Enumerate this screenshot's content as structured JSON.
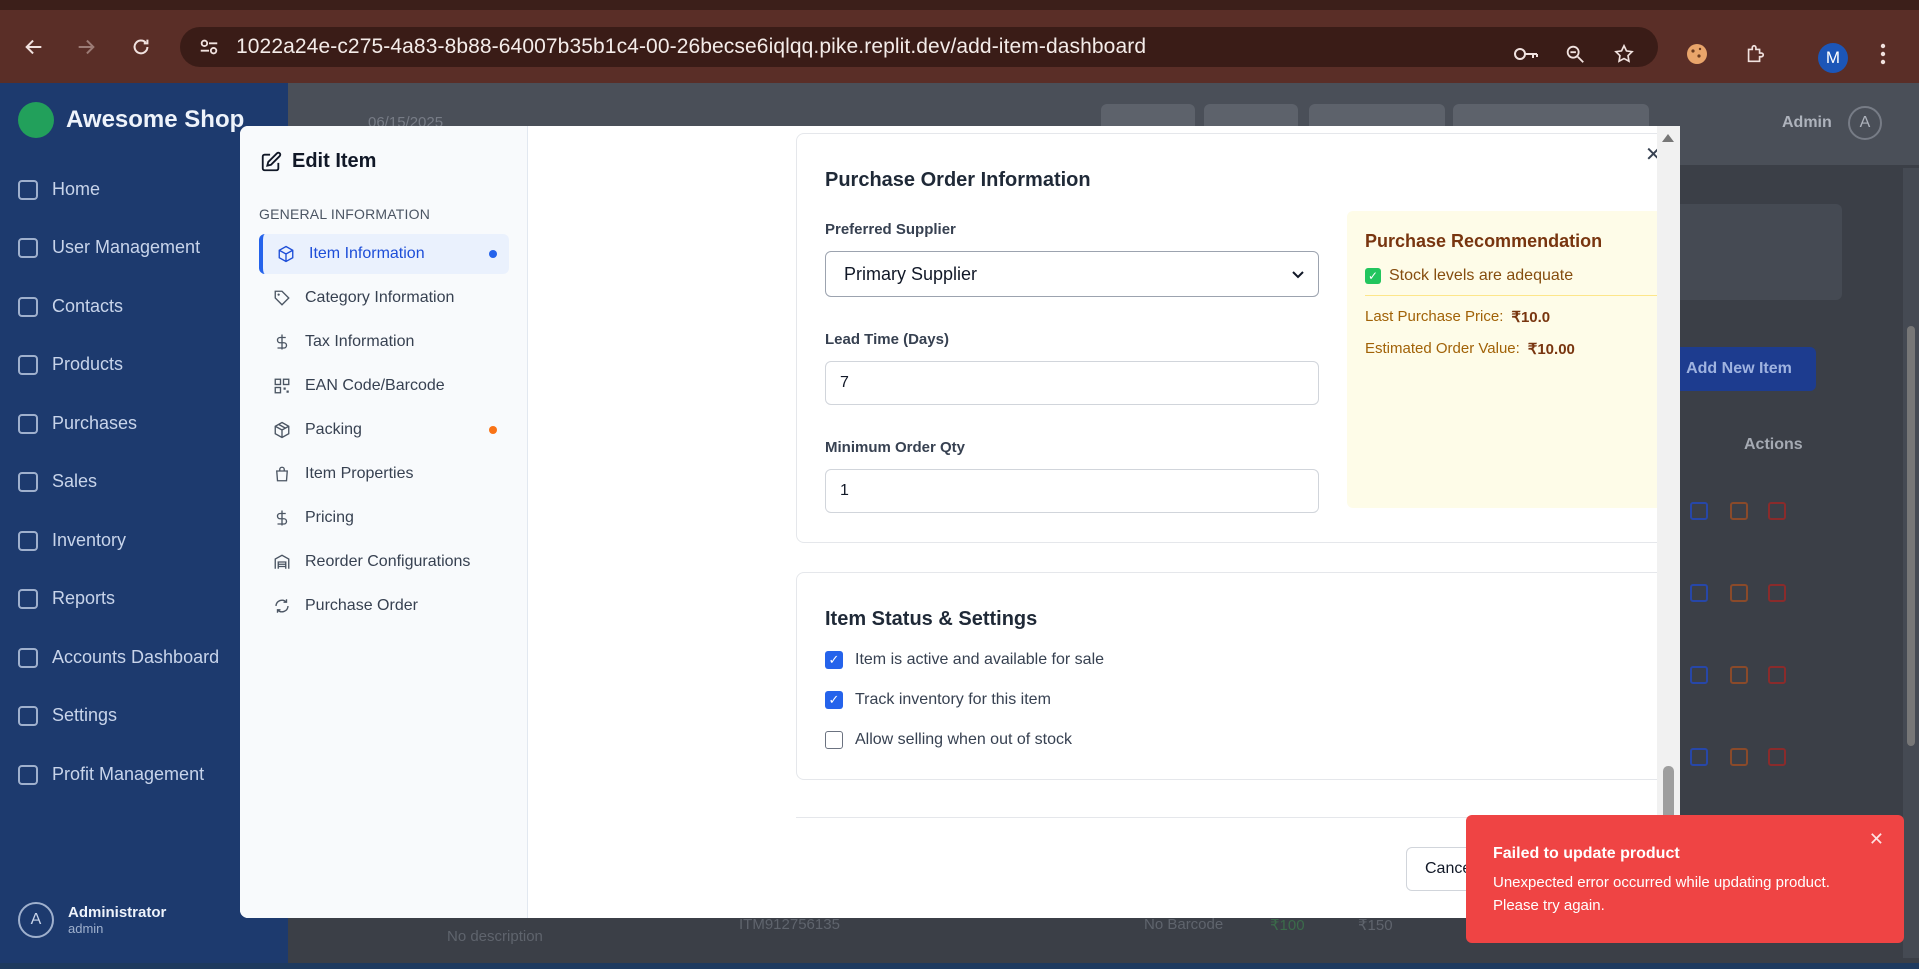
{
  "browser": {
    "url": "1022a24e-c275-4a83-8b88-64007b35b1c4-00-26becse6iqlqq.pike.replit.dev/add-item-dashboard",
    "profile_initial": "M"
  },
  "app": {
    "brand": "Awesome Shop",
    "header_date": "06/15/2025",
    "admin_label": "Admin",
    "admin_initial": "A",
    "sidebar": [
      {
        "label": "Home",
        "icon": "home-icon"
      },
      {
        "label": "User Management",
        "icon": "user-icon"
      },
      {
        "label": "Contacts",
        "icon": "contacts-icon"
      },
      {
        "label": "Products",
        "icon": "box-icon"
      },
      {
        "label": "Purchases",
        "icon": "download-icon"
      },
      {
        "label": "Sales",
        "icon": "bag-icon"
      },
      {
        "label": "Inventory",
        "icon": "package-icon"
      },
      {
        "label": "Reports",
        "icon": "chart-icon"
      },
      {
        "label": "Accounts Dashboard",
        "icon": "ledger-icon"
      },
      {
        "label": "Settings",
        "icon": "gear-icon"
      },
      {
        "label": "Profit Management",
        "icon": "rupee-icon"
      }
    ],
    "user": {
      "name": "Administrator",
      "role": "admin",
      "initial": "A"
    },
    "add_new_item": "Add New Item",
    "actions_header": "Actions",
    "bottom_row": {
      "description": "No description",
      "code": "ITM912756135",
      "barcode": "No Barcode",
      "price1": "₹100",
      "price2": "₹150"
    }
  },
  "modal": {
    "title": "Edit Item",
    "section": "GENERAL INFORMATION",
    "nav": [
      {
        "label": "Item Information",
        "icon": "cube-icon",
        "active": true,
        "dot": "#2563eb"
      },
      {
        "label": "Category Information",
        "icon": "tag-icon"
      },
      {
        "label": "Tax Information",
        "icon": "dollar-icon"
      },
      {
        "label": "EAN Code/Barcode",
        "icon": "qr-code-icon"
      },
      {
        "label": "Packing",
        "icon": "package-icon",
        "dot": "#f97316"
      },
      {
        "label": "Item Properties",
        "icon": "bag-icon"
      },
      {
        "label": "Pricing",
        "icon": "dollar-icon"
      },
      {
        "label": "Reorder Configurations",
        "icon": "warehouse-icon"
      },
      {
        "label": "Purchase Order",
        "icon": "refresh-icon"
      }
    ],
    "purchase": {
      "title": "Purchase Order Information",
      "supplier_label": "Preferred Supplier",
      "supplier_value": "Primary Supplier",
      "lead_label": "Lead Time (Days)",
      "lead_value": "7",
      "moq_label": "Minimum Order Qty",
      "moq_value": "1",
      "reco_title": "Purchase Recommendation",
      "reco_status": "Stock levels are adequate",
      "last_price_label": "Last Purchase Price:",
      "last_price_value": "₹10.0",
      "est_label": "Estimated Order Value:",
      "est_value": "₹10.00"
    },
    "status": {
      "title": "Item Status & Settings",
      "options": [
        {
          "label": "Item is active and available for sale",
          "checked": true
        },
        {
          "label": "Track inventory for this item",
          "checked": true
        },
        {
          "label": "Allow selling when out of stock",
          "checked": false
        }
      ]
    },
    "cancel": "Cancel"
  },
  "toast": {
    "title": "Failed to update product",
    "message": "Unexpected error occurred while updating product. Please try again."
  }
}
